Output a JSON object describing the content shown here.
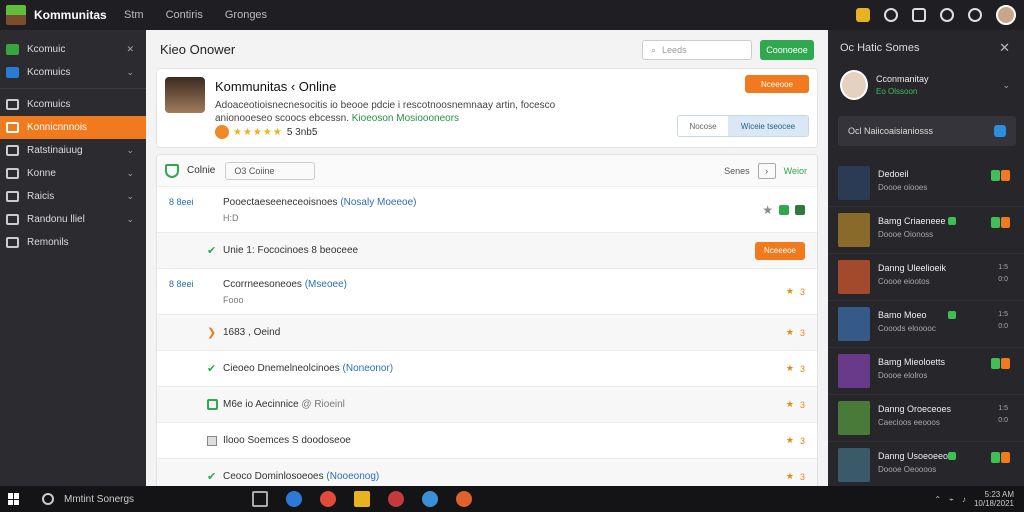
{
  "app": {
    "brand": "Kommunitas"
  },
  "topnav": [
    "Stm",
    "Contiris",
    "Gronges"
  ],
  "sidebar": {
    "items": [
      {
        "label": "Kcomuic",
        "chevron": true,
        "style": "green"
      },
      {
        "label": "Kcomuics",
        "chevron": true,
        "style": "blue"
      },
      {
        "label": "Kcomuics",
        "chevron": false,
        "style": "plain"
      },
      {
        "label": "Konnicnnnois",
        "chevron": false,
        "style": "active"
      },
      {
        "label": "Ratstinaiuug",
        "chevron": true,
        "style": "plain"
      },
      {
        "label": "Konne",
        "chevron": true,
        "style": "plain"
      },
      {
        "label": "Raicis",
        "chevron": true,
        "style": "plain"
      },
      {
        "label": "Randonu lliel",
        "chevron": true,
        "style": "plain"
      },
      {
        "label": "Remonils",
        "chevron": false,
        "style": "plain"
      }
    ]
  },
  "main": {
    "title": "Kieo Onower",
    "search_placeholder": "Leeds",
    "header_button": "Coonoeoe"
  },
  "profile": {
    "name": "Kommunitas ‹ Online",
    "desc": "Adoaceotioisnecnesocitis io beooe pdcie i rescotnoosnemnaay artin, focesco anionooeseo scoocs ebcessn.",
    "link": "Kioeoson Mosioooneors",
    "rating_text": "★★★★★",
    "rating_value": "5 3nb5",
    "action_button": "Nceeooe",
    "seg_left": "Nocose",
    "seg_right": "Wiceie tseocee"
  },
  "list": {
    "header_title": "Colnie",
    "header_search": "O3 Coiine",
    "header_sort": "Senes",
    "header_right": "Weior",
    "rows": [
      {
        "kind": "tall",
        "id": "8 8eei",
        "text": "Pooectaeseeneceoisnoes",
        "tag": "(Nosaly Moeeoe)",
        "sub": "H:D",
        "meta": "star-pills"
      },
      {
        "kind": "short",
        "check": "green",
        "text": "Unie 1: Fococinoes 8 beoceee",
        "meta": "button",
        "button": "Nceeeoe",
        "alt": true
      },
      {
        "kind": "tall",
        "id": "8 8eei",
        "text": "Ccorrneesoneoes",
        "tag": "(Mseoee)",
        "sub": "Fooo",
        "meta": "stars",
        "metatext": "3"
      },
      {
        "kind": "short",
        "check": "orange",
        "text": "1683 , Oeind",
        "meta": "stars",
        "metatext": "3",
        "alt": true
      },
      {
        "kind": "short",
        "check": "green",
        "text": "Cieoeo Dnemelneolcinoes",
        "tag": "(Noneonor)",
        "meta": "stars",
        "metatext": "3"
      },
      {
        "kind": "short",
        "check": "gbox",
        "text": "M6e io Aecinnice",
        "tag": "@ Rioeinl",
        "meta": "stars",
        "metatext": "3",
        "alt": true
      },
      {
        "kind": "short",
        "check": "box",
        "text": "Ilooo Soemces S doodoseoe",
        "meta": "stars",
        "metatext": "3"
      },
      {
        "kind": "short",
        "check": "green",
        "text": "Ceoco Dominlosoeoes",
        "tag": "(Nooeonog)",
        "meta": "stars",
        "metatext": "3"
      }
    ]
  },
  "rpanel": {
    "title": "Oc Hatic Somes",
    "username": "Cconmanitay",
    "userstatus": "Eo Olssoon",
    "notify": "Ocl Naiicoaisianiosss",
    "games": [
      {
        "title": "Dedoeil",
        "sub": "Doooe oiooes",
        "thumb": "#2b3b56",
        "status": [
          "#3fbf55",
          "#f07a1d"
        ]
      },
      {
        "title": "Bamg Criaeneee",
        "sub": "Doooe Oionoss",
        "thumb": "#8a6a2a",
        "status": [
          "#3fbf55",
          "#f07a1d"
        ],
        "badge": "green"
      },
      {
        "title": "Danng Uleelioeik",
        "sub": "Coooe eiootos",
        "thumb": "#a44a2c",
        "meta": [
          "1:5",
          "0:0"
        ]
      },
      {
        "title": "Bamo Moeo",
        "sub": "Cooods elooooc",
        "thumb": "#355a8a",
        "meta": [
          "1:5",
          "0:0"
        ],
        "badge": "green"
      },
      {
        "title": "Bamg Mieoloetts",
        "sub": "Doooe elolros",
        "thumb": "#6a3a8a",
        "status": [
          "#3fbf55",
          "#f07a1d"
        ]
      },
      {
        "title": "Danng Oroeceoes",
        "sub": "Caecioos eeooos",
        "thumb": "#4a7a3a",
        "meta": [
          "1:5",
          "0:0"
        ]
      },
      {
        "title": "Danng Usoeoeeoe",
        "sub": "Doooe Oeoooos",
        "thumb": "#3a5a6a",
        "status": [
          "#3fbf55",
          "#f07a1d"
        ],
        "badge": "green"
      }
    ]
  },
  "taskbar": {
    "search": "Mmtint Sonergs",
    "clock_line1": "5:23 AM",
    "clock_line2": "10/18/2021"
  }
}
